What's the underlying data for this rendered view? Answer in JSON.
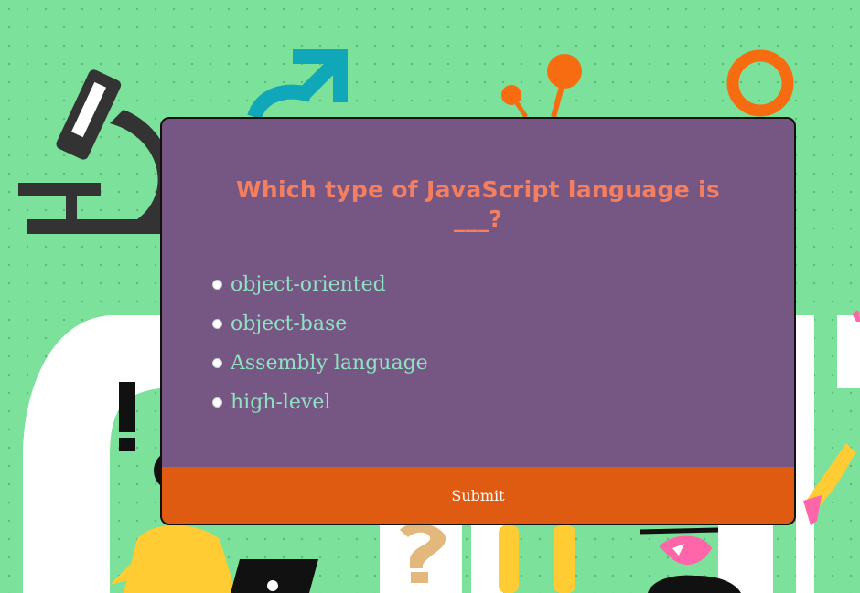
{
  "colors": {
    "background": "#7be19b",
    "card": "#765783",
    "title": "#f47f60",
    "answer_text": "#8fe1c2",
    "submit_button": "#df5b11",
    "submit_text": "#ffffff"
  },
  "quiz": {
    "question": "Which type of JavaScript language is ___?",
    "answers": [
      {
        "label": "object-oriented"
      },
      {
        "label": "object-base"
      },
      {
        "label": "Assembly language"
      },
      {
        "label": "high-level"
      }
    ],
    "submit_label": "Submit"
  },
  "background_icons": [
    "microscope-icon",
    "male-symbol-icon",
    "molecule-icon",
    "ring-icon",
    "exclamation-icon",
    "question-mark-icon",
    "laptop-icon",
    "person-illustration"
  ]
}
